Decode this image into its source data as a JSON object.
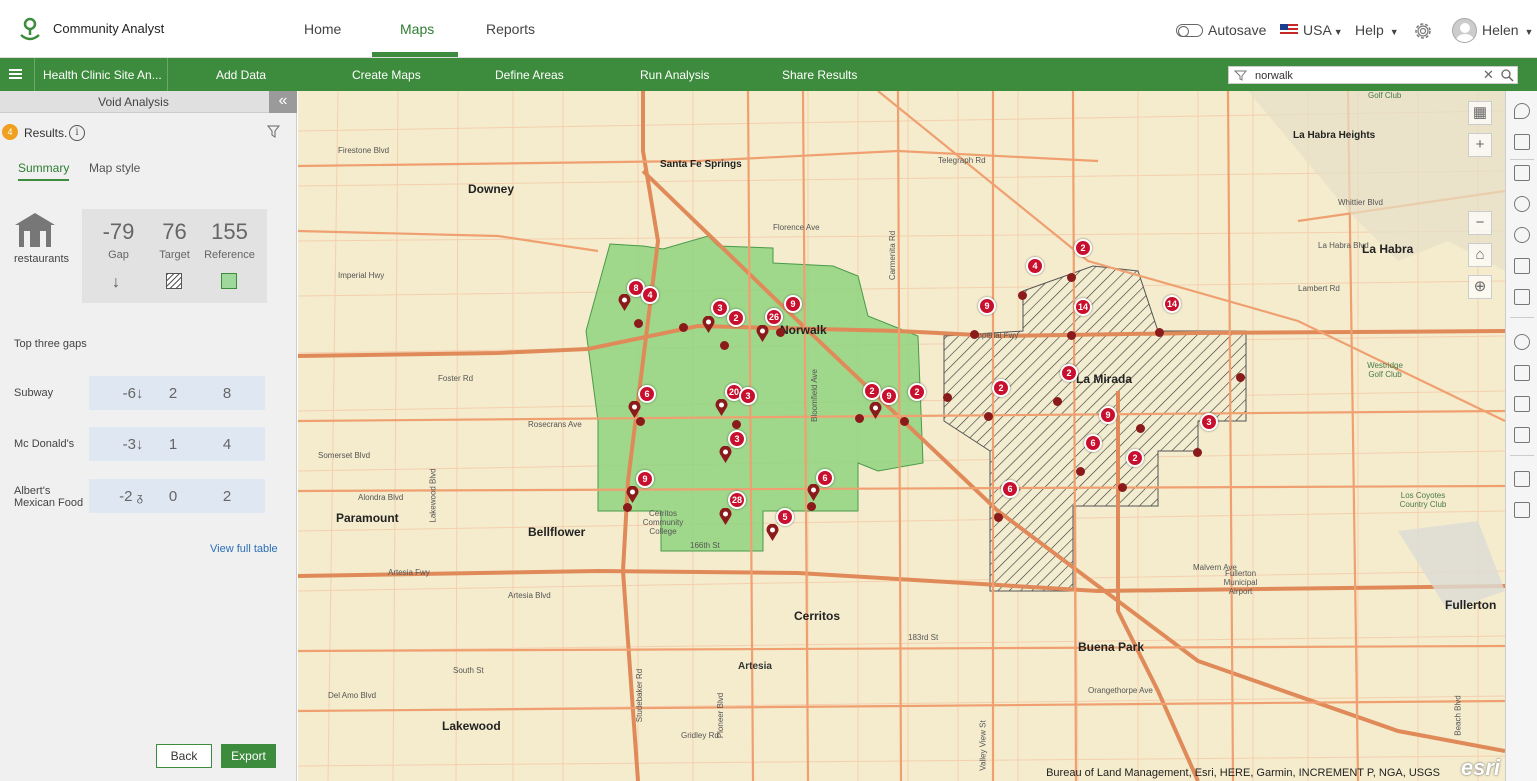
{
  "app": {
    "title": "Community Analyst"
  },
  "nav": {
    "tabs": [
      "Home",
      "Maps",
      "Reports"
    ],
    "active": "Maps"
  },
  "top_right": {
    "autosave": "Autosave",
    "country": "USA",
    "help": "Help",
    "user": "Helen"
  },
  "toolbar": {
    "project": "Health Clinic Site An...",
    "items": [
      "Add Data",
      "Create Maps",
      "Define Areas",
      "Run Analysis",
      "Share Results"
    ]
  },
  "search": {
    "value": "norwalk"
  },
  "panel": {
    "title": "Void Analysis",
    "results_count": "4",
    "results_label": "Results.",
    "tabs": [
      "Summary",
      "Map style"
    ],
    "category": "restaurants",
    "stats": [
      {
        "value": "-79",
        "label": "Gap"
      },
      {
        "value": "76",
        "label": "Target"
      },
      {
        "value": "155",
        "label": "Reference"
      }
    ],
    "top_gaps_title": "Top three gaps",
    "gaps": [
      {
        "name": "Subway",
        "gap": "-6",
        "target": "2",
        "reference": "8"
      },
      {
        "name": "Mc Donald's",
        "gap": "-3",
        "target": "1",
        "reference": "4"
      },
      {
        "name": "Albert's Mexican Food",
        "gap": "-2",
        "target": "0",
        "reference": "2"
      }
    ],
    "view_full": "View full table",
    "back": "Back",
    "export": "Export"
  },
  "map": {
    "cities": [
      "Downey",
      "Santa Fe Springs",
      "Norwalk",
      "La Mirada",
      "La Habra",
      "La Habra Heights",
      "Paramount",
      "Bellflower",
      "Cerritos",
      "Buena Park",
      "Lakewood",
      "Fullerton",
      "Artesia"
    ],
    "streets": [
      "Firestone Blvd",
      "Imperial Hwy",
      "Foster Rd",
      "Rosecrans Ave",
      "Alondra Blvd",
      "Artesia Fwy",
      "Artesia Blvd",
      "South St",
      "Florence Ave",
      "Telegraph Rd",
      "Whittier Blvd",
      "La Habra Blvd",
      "Lambert Rd",
      "Imperial Fwy",
      "Somerset Blvd",
      "Orangethorpe Ave",
      "Malvern Ave",
      "Del Amo Blvd",
      "Lakewood Blvd",
      "Studebaker Rd",
      "Pioneer Blvd",
      "Bloomfield Ave",
      "Carmenita Rd",
      "Valley View St",
      "Beach Blvd",
      "183rd St",
      "166th St",
      "Gridley Rd",
      "Cerritos Community College",
      "Los Coyotes Country Club",
      "Westridge Golf Club",
      "Golf Club",
      "Fullerton Municipal Airport"
    ],
    "clusters": [
      "8",
      "4",
      "3",
      "2",
      "26",
      "9",
      "6",
      "20",
      "3",
      "3",
      "9",
      "28",
      "5",
      "6",
      "2",
      "9",
      "2",
      "2",
      "9",
      "4",
      "2",
      "14",
      "14",
      "2",
      "9",
      "6",
      "2",
      "3",
      "6"
    ],
    "attribution": "Bureau of Land Management, Esri, HERE, Garmin, INCREMENT P, NGA, USGS",
    "brand": "esri"
  },
  "colors": {
    "brand_green": "#3d8b3d",
    "cluster_red": "#c8102e",
    "target_area": "#8fd37f"
  }
}
